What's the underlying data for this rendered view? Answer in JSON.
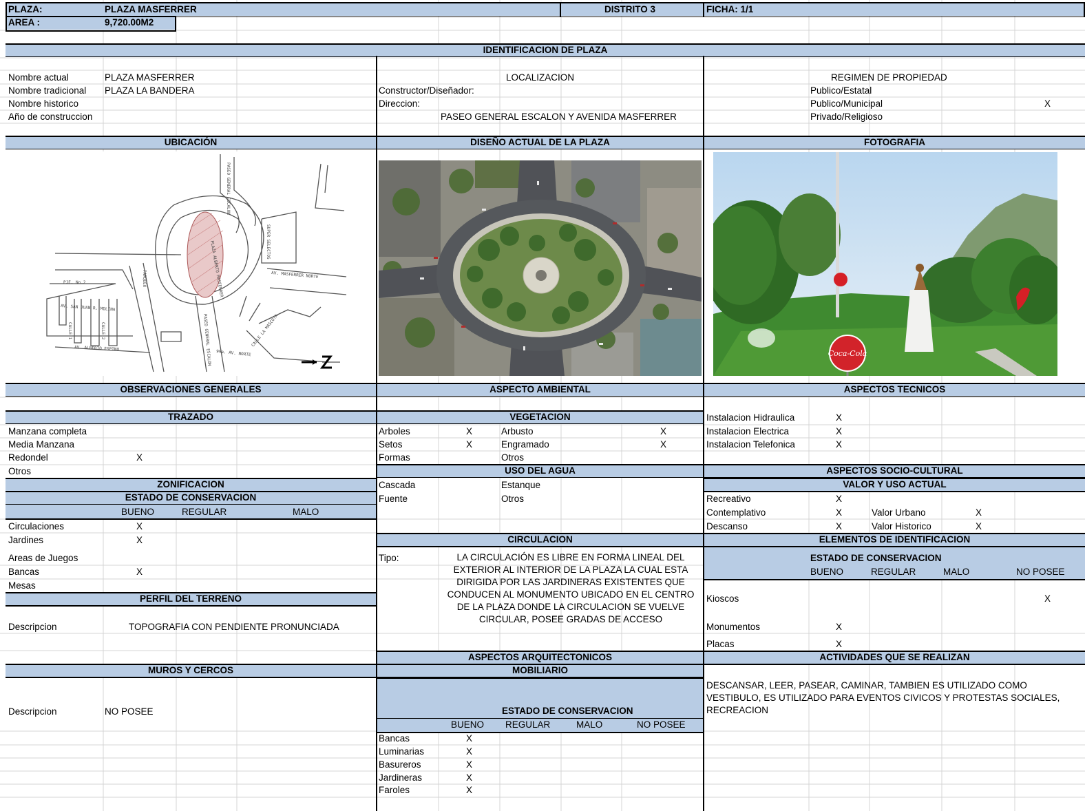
{
  "top": {
    "plaza_label": "PLAZA:",
    "plaza_value": "PLAZA MASFERRER",
    "distrito": "DISTRITO 3",
    "ficha": "FICHA: 1/1",
    "area_label": "AREA :",
    "area_value": "9,720.00M2"
  },
  "identificacion": {
    "title": "IDENTIFICACION DE  PLAZA",
    "nombre_actual_label": "Nombre actual",
    "nombre_actual": "PLAZA MASFERRER",
    "nombre_tradicional_label": "Nombre tradicional",
    "nombre_tradicional": "PLAZA LA BANDERA",
    "nombre_historico_label": "Nombre historico",
    "anio_label": "Año de construccion",
    "localizacion": "LOCALIZACION",
    "constructor_label": "Constructor/Diseñador:",
    "direccion_label": "Direccion:",
    "direccion": "PASEO GENERAL ESCALON Y AVENIDA MASFERRER",
    "regimen": "REGIMEN DE PROPIEDAD",
    "regimen_items": [
      "Publico/Estatal",
      "Publico/Municipal",
      "Privado/Religioso"
    ],
    "regimen_mark": "X"
  },
  "sections": {
    "ubicacion": "UBICACIÓN",
    "diseno": "DISEÑO ACTUAL DE LA PLAZA",
    "fotografia": "FOTOGRAFIA",
    "observaciones": "OBSERVACIONES GENERALES",
    "ambiental": "ASPECTO AMBIENTAL",
    "tecnicos": "ASPECTOS TECNICOS"
  },
  "map_labels": {
    "paseo_top": "PASEO GENERAL ESCALON",
    "super": "SUPER SELECTOS",
    "plaza": "PLAZA ALBERTO MASFERRER",
    "parqueo": "PARQUEO",
    "masferrer": "AV. MASFERRER NORTE",
    "pje": "PJE. No.2",
    "san_juan": "AV. SAN JUAN R. MOLINA",
    "calle1": "CALLE 1",
    "calle2": "CALLE 2",
    "espino": "AV. ALBERTO ESPINO",
    "paseo_bottom": "PASEO GENERAL ESCALON",
    "norte": "99a. AV. NORTE",
    "calle_la_mascota": "CALLE LA MASCOTA"
  },
  "photo": {
    "sign": "Coca-Cola"
  },
  "trazado": {
    "title": "TRAZADO",
    "items": [
      "Manzana completa",
      "Media Manzana",
      "Redondel",
      "Otros"
    ],
    "redondel_mark": "X"
  },
  "zonificacion": {
    "title": "ZONIFICACION",
    "estado_title": "ESTADO DE CONSERVACION",
    "cols": [
      "BUENO",
      "REGULAR",
      "MALO"
    ],
    "items": [
      "Circulaciones",
      "Jardines",
      "Areas de Juegos",
      "Bancas",
      "Mesas"
    ],
    "mark": "X"
  },
  "perfil": {
    "title": "PERFIL DEL TERRENO",
    "label": "Descripcion",
    "value": "TOPOGRAFIA CON PENDIENTE PRONUNCIADA"
  },
  "muros": {
    "title": "MUROS Y CERCOS",
    "label": "Descripcion",
    "value": "NO POSEE"
  },
  "vegetacion": {
    "title": "VEGETACION",
    "arboles": "Arboles",
    "arbusto": "Arbusto",
    "setos": "Setos",
    "engramado": "Engramado",
    "formas": "Formas",
    "otros": "Otros",
    "mark": "X"
  },
  "agua": {
    "title": "USO DEL AGUA",
    "cascada": "Cascada",
    "estanque": "Estanque",
    "fuente": "Fuente",
    "otros": "Otros"
  },
  "circulacion": {
    "title": "CIRCULACION",
    "label": "Tipo:",
    "text": "LA CIRCULACIÓN ES LIBRE EN FORMA LINEAL DEL EXTERIOR AL INTERIOR DE LA PLAZA  LA CUAL ESTA DIRIGIDA POR LAS JARDINERAS EXISTENTES QUE CONDUCEN AL MONUMENTO   UBICADO EN EL CENTRO  DE LA PLAZA DONDE LA CIRCULACION SE VUELVE CIRCULAR, POSEE GRADAS DE ACCESO"
  },
  "arquitectonicos": {
    "title": "ASPECTOS ARQUITECTONICOS",
    "mobiliario": "MOBILIARIO",
    "estado_title": "ESTADO DE CONSERVACION",
    "cols": [
      "BUENO",
      "REGULAR",
      "MALO",
      "NO POSEE"
    ],
    "items": [
      "Bancas",
      "Luminarias",
      "Basureros",
      "Jardineras",
      "Faroles"
    ],
    "mark": "X"
  },
  "tecnicos": {
    "items": [
      "Instalacion Hidraulica",
      "Instalacion Electrica",
      "Instalacion Telefonica"
    ],
    "mark": "X"
  },
  "socio": {
    "title": "ASPECTOS SOCIO-CULTURAL",
    "sub": "VALOR   Y USO ACTUAL",
    "items": [
      "Recreativo",
      "Contemplativo",
      "Descanso"
    ],
    "valor_urbano": "Valor Urbano",
    "valor_historico": "Valor Historico",
    "mark": "X"
  },
  "elementos": {
    "title": "ELEMENTOS DE IDENTIFICACION",
    "estado_title": "ESTADO DE CONSERVACION",
    "cols": [
      "BUENO",
      "REGULAR",
      "MALO",
      "NO POSEE"
    ],
    "items": [
      "Kioscos",
      "Monumentos",
      "Placas"
    ],
    "mark": "X"
  },
  "actividades": {
    "title": "ACTIVIDADES QUE SE REALIZAN",
    "text": "DESCANSAR, LEER,  PASEAR, CAMINAR,   TAMBIEN  ES UTILIZADO COMO VESTIBULO,   ES UTILIZADO PARA EVENTOS CIVICOS Y PROTESTAS SOCIALES, RECREACION"
  },
  "colors": {
    "header_fill": "#b8cce4",
    "grid": "#d4d4d4"
  }
}
